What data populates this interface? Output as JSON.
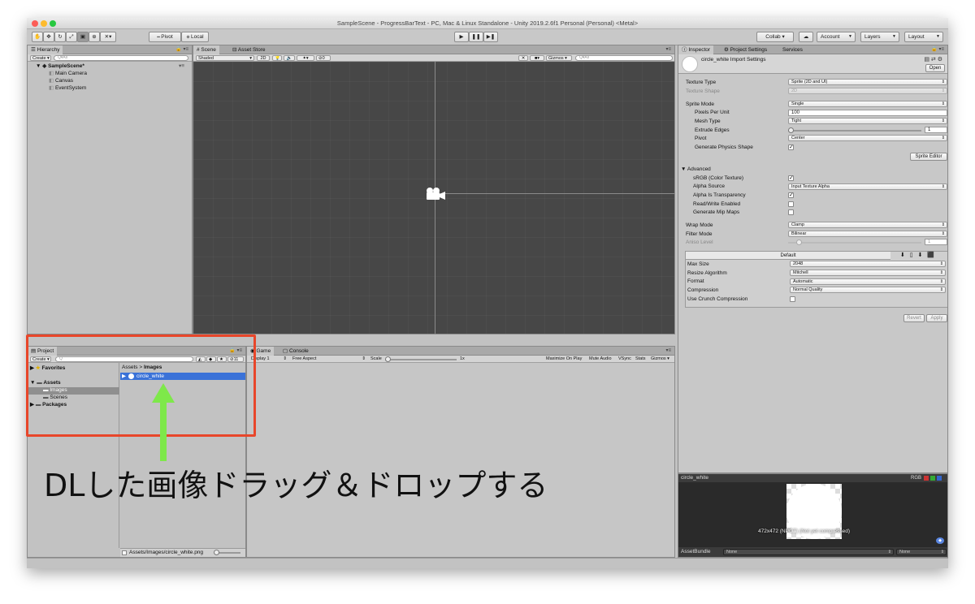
{
  "window": {
    "title": "SampleScene - ProgressBarText - PC, Mac & Linux Standalone - Unity 2019.2.6f1 Personal (Personal) <Metal>"
  },
  "toolbar": {
    "pivot": "Pivot",
    "local": "Local",
    "collab": "Collab ▾",
    "account": "Account",
    "layers": "Layers",
    "layout": "Layout"
  },
  "hierarchy": {
    "tab": "Hierarchy",
    "create": "Create",
    "search_placeholder": "Q▾All",
    "scene": "SampleScene*",
    "items": [
      "Main Camera",
      "Canvas",
      "EventSystem"
    ]
  },
  "scene": {
    "tabs": [
      "Scene",
      "Asset Store"
    ],
    "shaded": "Shaded",
    "mode_2d": "2D",
    "hidden_count": "0",
    "gizmos": "Gizmos",
    "search_placeholder": "Q▾All"
  },
  "project": {
    "tab": "Project",
    "create": "Create",
    "eye_count": "11",
    "favorites": "Favorites",
    "assets": "Assets",
    "images": "Images",
    "scenes": "Scenes",
    "packages": "Packages",
    "breadcrumb_root": "Assets",
    "breadcrumb_sep": ">",
    "breadcrumb_leaf": "Images",
    "file": "circle_white",
    "footer_path": "Assets/Images/circle_white.png"
  },
  "game": {
    "tabs": [
      "Game",
      "Console"
    ],
    "display": "Display 1",
    "aspect": "Free Aspect",
    "scale_label": "Scale",
    "scale_value": "1x",
    "buttons": [
      "Maximize On Play",
      "Mute Audio",
      "VSync",
      "Stats",
      "Gizmos"
    ]
  },
  "inspector": {
    "tabs": [
      "Inspector",
      "Project Settings",
      "Services"
    ],
    "header_title": "circle_white Import Settings",
    "open": "Open",
    "fields": {
      "texture_type": {
        "label": "Texture Type",
        "value": "Sprite (2D and UI)"
      },
      "texture_shape": {
        "label": "Texture Shape",
        "value": "2D"
      },
      "sprite_mode": {
        "label": "Sprite Mode",
        "value": "Single"
      },
      "pixels_per_unit": {
        "label": "Pixels Per Unit",
        "value": "100"
      },
      "mesh_type": {
        "label": "Mesh Type",
        "value": "Tight"
      },
      "extrude_edges": {
        "label": "Extrude Edges",
        "value": "1"
      },
      "pivot": {
        "label": "Pivot",
        "value": "Center"
      },
      "generate_physics_shape": {
        "label": "Generate Physics Shape",
        "checked": true
      }
    },
    "sprite_editor": "Sprite Editor",
    "advanced": {
      "title": "Advanced",
      "srgb": {
        "label": "sRGB (Color Texture)",
        "checked": true
      },
      "alpha_source": {
        "label": "Alpha Source",
        "value": "Input Texture Alpha"
      },
      "alpha_is_transparency": {
        "label": "Alpha Is Transparency",
        "checked": true
      },
      "read_write": {
        "label": "Read/Write Enabled",
        "checked": false
      },
      "mip_maps": {
        "label": "Generate Mip Maps",
        "checked": false
      }
    },
    "wrap_mode": {
      "label": "Wrap Mode",
      "value": "Clamp"
    },
    "filter_mode": {
      "label": "Filter Mode",
      "value": "Bilinear"
    },
    "aniso_level": {
      "label": "Aniso Level",
      "value": "1"
    },
    "platform": {
      "default_tab": "Default",
      "max_size": {
        "label": "Max Size",
        "value": "2048"
      },
      "resize": {
        "label": "Resize Algorithm",
        "value": "Mitchell"
      },
      "format": {
        "label": "Format",
        "value": "Automatic"
      },
      "compression": {
        "label": "Compression",
        "value": "Normal Quality"
      },
      "crunch": {
        "label": "Use Crunch Compression",
        "checked": false
      }
    },
    "revert": "Revert",
    "apply": "Apply"
  },
  "preview": {
    "title": "circle_white",
    "rgb": "RGB",
    "info": "472x472 (NPOT) (Not yet compressed)",
    "assetbundle_label": "AssetBundle",
    "bundle_value": "None",
    "variant_value": "None"
  },
  "annotation": {
    "text": "DLした画像ドラッグ＆ドロップする",
    "box_color": "#e8462a",
    "arrow_color": "#7ee84a"
  }
}
